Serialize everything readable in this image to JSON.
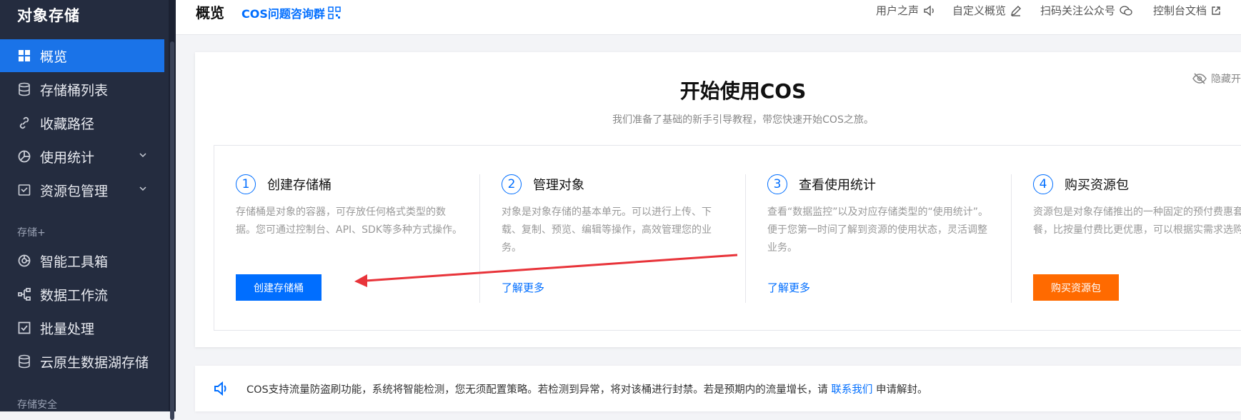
{
  "sidebar": {
    "brand": "对象存储",
    "items": [
      {
        "label": "概览",
        "icon": "dashboard-icon"
      },
      {
        "label": "存储桶列表",
        "icon": "bucket-icon"
      },
      {
        "label": "收藏路径",
        "icon": "link-icon"
      },
      {
        "label": "使用统计",
        "icon": "pie-chart-icon"
      },
      {
        "label": "资源包管理",
        "icon": "package-icon"
      },
      {
        "label": "智能工具箱",
        "icon": "toolbox-icon"
      },
      {
        "label": "数据工作流",
        "icon": "workflow-icon"
      },
      {
        "label": "批量处理",
        "icon": "checkbox-icon"
      },
      {
        "label": "云原生数据湖存储",
        "icon": "datalake-icon"
      }
    ],
    "sections": [
      "存储+",
      "存储安全"
    ]
  },
  "header": {
    "title": "概览",
    "cos_group": "COS问题咨询群",
    "links": [
      "用户之声",
      "自定义概览",
      "扫码关注公众号",
      "控制台文档"
    ]
  },
  "hero": {
    "title": "开始使用COS",
    "subtitle": "我们准备了基础的新手引导教程，带您快速开始COS之旅。",
    "hide_label": "隐藏开"
  },
  "steps": [
    {
      "num": "1",
      "title": "创建存储桶",
      "desc": "存储桶是对象的容器，可存放任何格式类型的数据。您可通过控制台、API、SDK等多种方式操作。",
      "action": "创建存储桶"
    },
    {
      "num": "2",
      "title": "管理对象",
      "desc": "对象是对象存储的基本单元。可以进行上传、下载、复制、预览、编辑等操作，高效管理您的业务。",
      "action": "了解更多"
    },
    {
      "num": "3",
      "title": "查看使用统计",
      "desc": "查看“数据监控”以及对应存储类型的“使用统计”。便于您第一时间了解到资源的使用状态，灵活调整业务。",
      "action": "了解更多"
    },
    {
      "num": "4",
      "title": "购买资源包",
      "desc": "资源包是对象存储推出的一种固定的预付费惠套餐，比按量付费比更优惠，可以根据实需求选购。",
      "action": "购买资源包"
    }
  ],
  "notice": {
    "text": "COS支持流量防盗刷功能，系统将智能检测，您无须配置策略。若检测到异常，将对该桶进行封禁。若是预期内的流量增长，请",
    "link": "联系我们",
    "suffix": "申请解封。"
  },
  "colors": {
    "accent": "#006eff",
    "sidebar": "#242c3f",
    "orange": "#ff6a00",
    "annotation_arrow": "#e8343a"
  }
}
